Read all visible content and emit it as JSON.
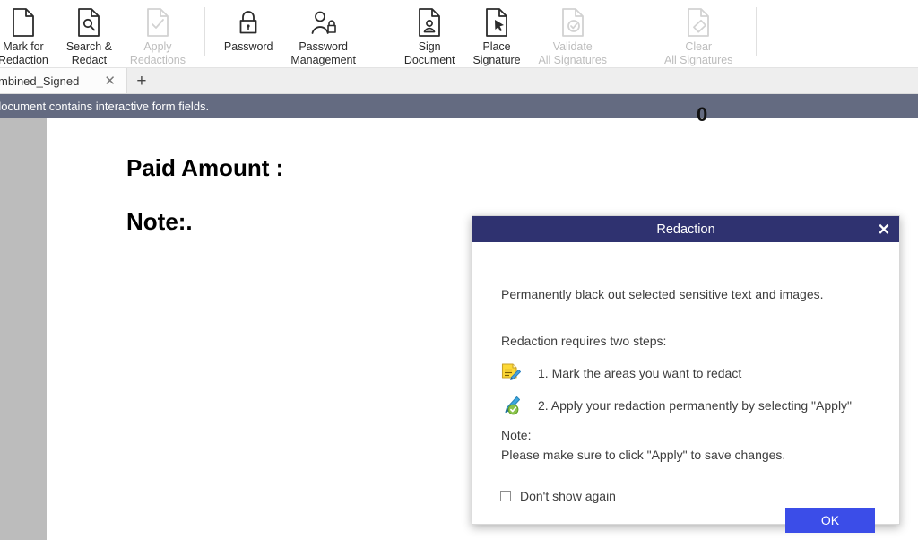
{
  "toolbar": {
    "items": [
      {
        "label": "Mark for\nRedaction",
        "icon": "mark-for-redaction-icon",
        "disabled": false
      },
      {
        "label": "Search &\nRedact",
        "icon": "search-and-redact-icon",
        "disabled": false
      },
      {
        "label": "Apply\nRedactions",
        "icon": "apply-redactions-icon",
        "disabled": true
      },
      {
        "label": "Password",
        "icon": "password-icon",
        "disabled": false
      },
      {
        "label": "Password\nManagement",
        "icon": "password-management-icon",
        "disabled": false
      },
      {
        "label": "Sign\nDocument",
        "icon": "sign-document-icon",
        "disabled": false
      },
      {
        "label": "Place\nSignature",
        "icon": "place-signature-icon",
        "disabled": false
      },
      {
        "label": "Validate\nAll Signatures",
        "icon": "validate-all-signatures-icon",
        "disabled": true
      },
      {
        "label": "Clear\nAll Signatures",
        "icon": "clear-all-signatures-icon",
        "disabled": true
      }
    ]
  },
  "tabbar": {
    "tab_title": "mbined_Signed",
    "close_glyph": "✕",
    "new_tab_glyph": "+"
  },
  "notification": {
    "message": "document contains interactive form fields.",
    "background": "#646b81"
  },
  "document": {
    "paid_amount_label": "Paid Amount :",
    "note_label": "Note:.",
    "field_value": "0"
  },
  "dialog": {
    "title": "Redaction",
    "close_glyph": "✕",
    "title_background": "#2f3270",
    "intro": "Permanently black out selected sensitive text and images.",
    "steps_label": "Redaction requires two steps:",
    "steps": [
      {
        "icon": "mark-areas-pencil-document-icon",
        "text": "1. Mark the areas you want to redact"
      },
      {
        "icon": "apply-redaction-highlighter-check-icon",
        "text": "2. Apply your redaction permanently by selecting \"Apply\""
      }
    ],
    "note_label": "Note:",
    "note_text": "Please make sure to click \"Apply\" to save changes.",
    "dont_show_again_label": "Don't show again",
    "dont_show_again_checked": false,
    "ok_label": "OK",
    "ok_color": "#3b4de8"
  }
}
